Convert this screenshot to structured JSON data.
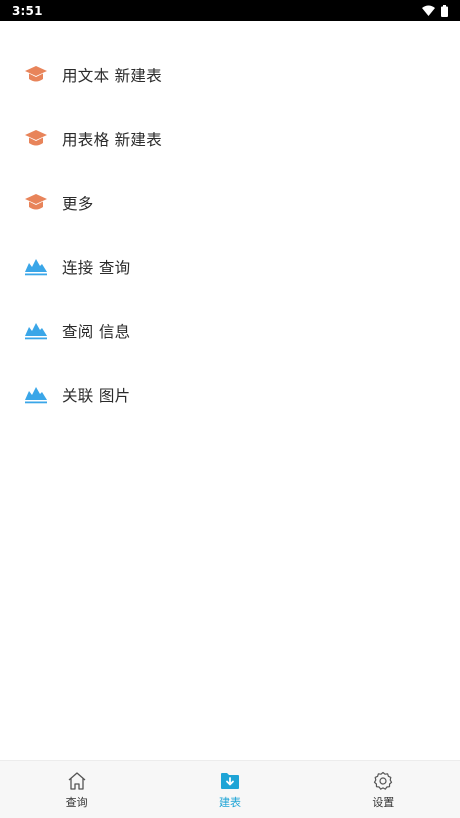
{
  "status_bar": {
    "time": "3:51",
    "icons": [
      "wifi-icon",
      "battery-icon"
    ]
  },
  "menu": {
    "items": [
      {
        "label": "用文本 新建表",
        "icon": "graduation-cap-icon"
      },
      {
        "label": "用表格 新建表",
        "icon": "graduation-cap-icon"
      },
      {
        "label": "更多",
        "icon": "graduation-cap-icon"
      },
      {
        "label": "连接 查询",
        "icon": "mountain-chart-icon"
      },
      {
        "label": "查阅 信息",
        "icon": "mountain-chart-icon"
      },
      {
        "label": "关联 图片",
        "icon": "mountain-chart-icon"
      }
    ]
  },
  "bottom_nav": {
    "items": [
      {
        "label": "查询",
        "icon": "home-icon",
        "active": false
      },
      {
        "label": "建表",
        "icon": "folder-download-icon",
        "active": true
      },
      {
        "label": "设置",
        "icon": "gear-icon",
        "active": false
      }
    ]
  },
  "colors": {
    "accent": "#1ea4d6",
    "cap_icon": "#e8845a",
    "chart_icon": "#3aa6e8",
    "status_bar_bg": "#000000",
    "bottom_nav_bg": "#f7f7f7"
  }
}
